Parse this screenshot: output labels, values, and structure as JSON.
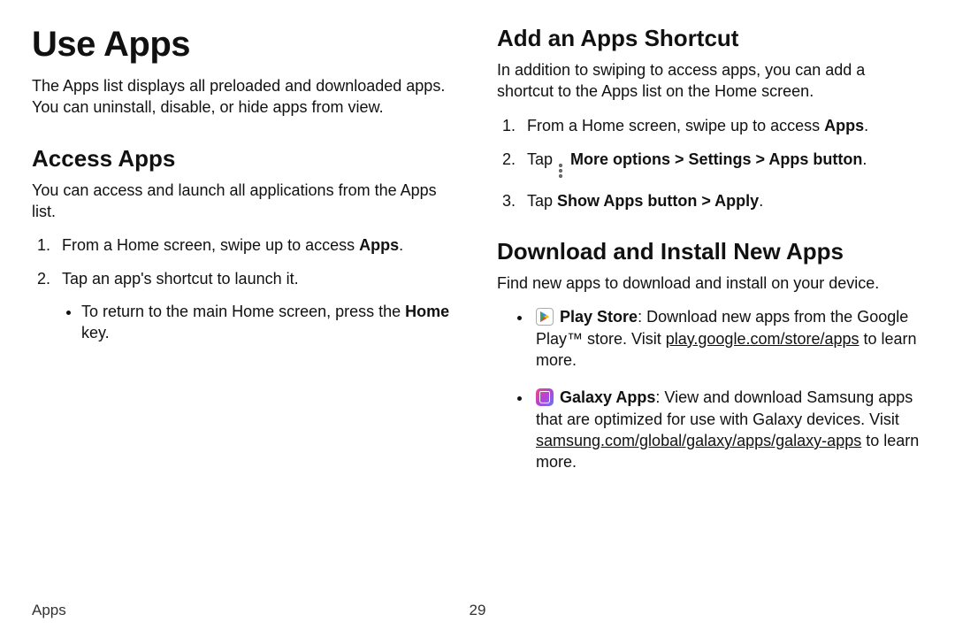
{
  "left": {
    "h1": "Use Apps",
    "intro": "The Apps list displays all preloaded and downloaded apps. You can uninstall, disable, or hide apps from view.",
    "h2": "Access Apps",
    "p1": "You can access and launch all applications from the Apps list.",
    "step1_pre": "From a Home screen, swipe up to access ",
    "step1_bold": "Apps",
    "step1_post": ".",
    "step2": "Tap an app's shortcut to launch it.",
    "sub_pre": "To return to the main Home screen, press the ",
    "sub_bold": "Home",
    "sub_post": " key."
  },
  "right": {
    "h2a": "Add an Apps Shortcut",
    "pa": "In addition to swiping to access apps, you can add a shortcut to the Apps list on the Home screen.",
    "a1_pre": "From a Home screen, swipe up to access ",
    "a1_bold": "Apps",
    "a1_post": ".",
    "a2_pre": "Tap ",
    "a2_bold": "More options > Settings > Apps button",
    "a2_post": ".",
    "a3_pre": "Tap ",
    "a3_bold": "Show Apps button > Apply",
    "a3_post": ".",
    "h2b": "Download and Install New Apps",
    "pb": "Find new apps to download and install on your device.",
    "ps_bold": "Play Store",
    "ps_t1": ": Download new apps from the Google Play™ store. Visit ",
    "ps_link": "play.google.com/store/apps",
    "ps_t2": " to learn more.",
    "ga_bold": "Galaxy Apps",
    "ga_t1": ": View and download Samsung apps that are optimized for use with Galaxy devices. Visit ",
    "ga_link": "samsung.com/global/galaxy/apps/galaxy-apps",
    "ga_t2": " to learn more."
  },
  "footer": {
    "section": "Apps",
    "page": "29"
  }
}
